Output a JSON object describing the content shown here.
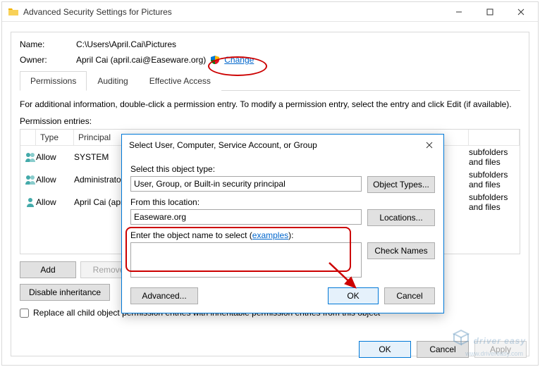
{
  "window": {
    "title": "Advanced Security Settings for Pictures"
  },
  "header": {
    "name_label": "Name:",
    "name_value": "C:\\Users\\April.Cai\\Pictures",
    "owner_label": "Owner:",
    "owner_value": "April Cai (april.cai@Easeware.org)",
    "change_link": "Change"
  },
  "tabs": {
    "permissions": "Permissions",
    "auditing": "Auditing",
    "effective": "Effective Access"
  },
  "info_text": "For additional information, double-click a permission entry. To modify a permission entry, select the entry and click Edit (if available).",
  "perm_label": "Permission entries:",
  "perm_columns": {
    "type": "Type",
    "principal": "Principal",
    "applies": ""
  },
  "perm_entries": [
    {
      "type": "Allow",
      "principal": "SYSTEM",
      "applies": "subfolders and files"
    },
    {
      "type": "Allow",
      "principal": "Administrators",
      "applies": "subfolders and files"
    },
    {
      "type": "Allow",
      "principal": "April Cai (april",
      "applies": "subfolders and files"
    }
  ],
  "buttons": {
    "add": "Add",
    "remove": "Remove",
    "disable_inheritance": "Disable inheritance",
    "ok": "OK",
    "cancel": "Cancel",
    "apply": "Apply"
  },
  "checkbox": {
    "replace_label": "Replace all child object permission entries with inheritable permission entries from this object"
  },
  "dialog": {
    "title": "Select User, Computer, Service Account, or Group",
    "object_type_label": "Select this object type:",
    "object_type_value": "User, Group, or Built-in security principal",
    "object_types_btn": "Object Types...",
    "location_label": "From this location:",
    "location_value": "Easeware.org",
    "locations_btn": "Locations...",
    "enter_label_prefix": "Enter the object name to select (",
    "examples_link": "examples",
    "enter_label_suffix": "):",
    "object_name_value": "",
    "check_names_btn": "Check Names",
    "advanced_btn": "Advanced...",
    "ok_btn": "OK",
    "cancel_btn": "Cancel"
  },
  "watermark": {
    "brand": "driver easy",
    "url": "www.drivereasy.com"
  }
}
